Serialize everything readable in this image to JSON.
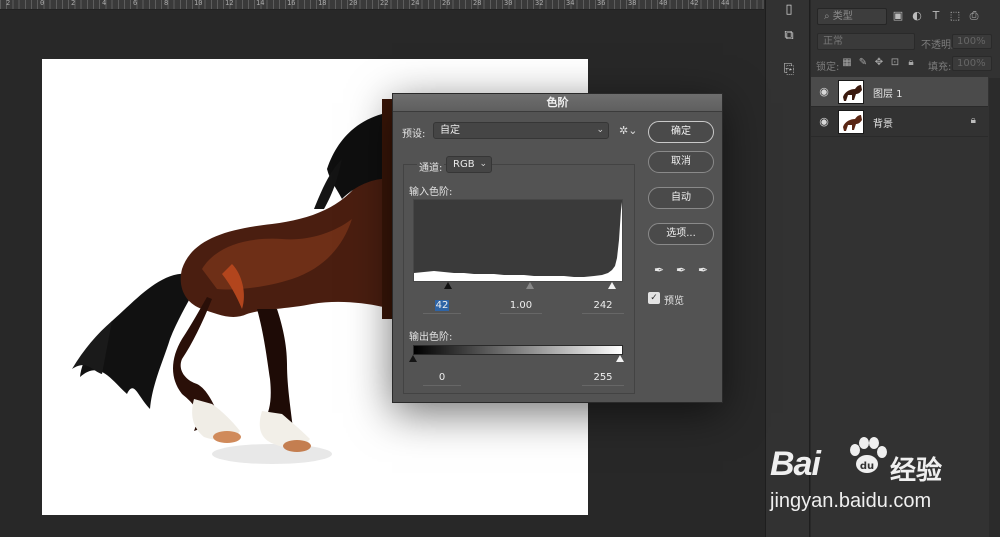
{
  "ruler": {
    "labels": [
      "2",
      "0",
      "2",
      "4",
      "6",
      "8",
      "10",
      "12",
      "14",
      "16",
      "18",
      "20",
      "22",
      "24",
      "26",
      "28",
      "30",
      "32",
      "34",
      "36",
      "38",
      "40",
      "42",
      "44"
    ]
  },
  "layers_panel": {
    "filter_kind": "类型",
    "blend_mode": "正常",
    "opacity_label": "不透明度:",
    "opacity_value": "100%",
    "lock_label": "锁定:",
    "fill_label": "填充:",
    "fill_value": "100%",
    "layers": [
      {
        "name": "图层 1",
        "active": true
      },
      {
        "name": "背景",
        "locked": true
      }
    ]
  },
  "levels_dialog": {
    "title": "色阶",
    "preset_label": "预设:",
    "preset_value": "自定",
    "channel_label": "通道:",
    "channel_value": "RGB",
    "input_levels_label": "输入色阶:",
    "input_black": "42",
    "input_gamma": "1.00",
    "input_white": "242",
    "input_black_fraction": 0.165,
    "input_gamma_fraction": 0.555,
    "input_white_fraction": 0.949,
    "output_levels_label": "输出色阶:",
    "output_black": "0",
    "output_white": "255",
    "buttons": {
      "ok": "确定",
      "cancel": "取消",
      "auto": "自动",
      "options": "选项..."
    },
    "preview_label": "预览",
    "preview_checked": true
  },
  "watermark": {
    "brand_latin": "Bai",
    "brand_cn": "经验",
    "url": "jingyan.baidu.com"
  }
}
